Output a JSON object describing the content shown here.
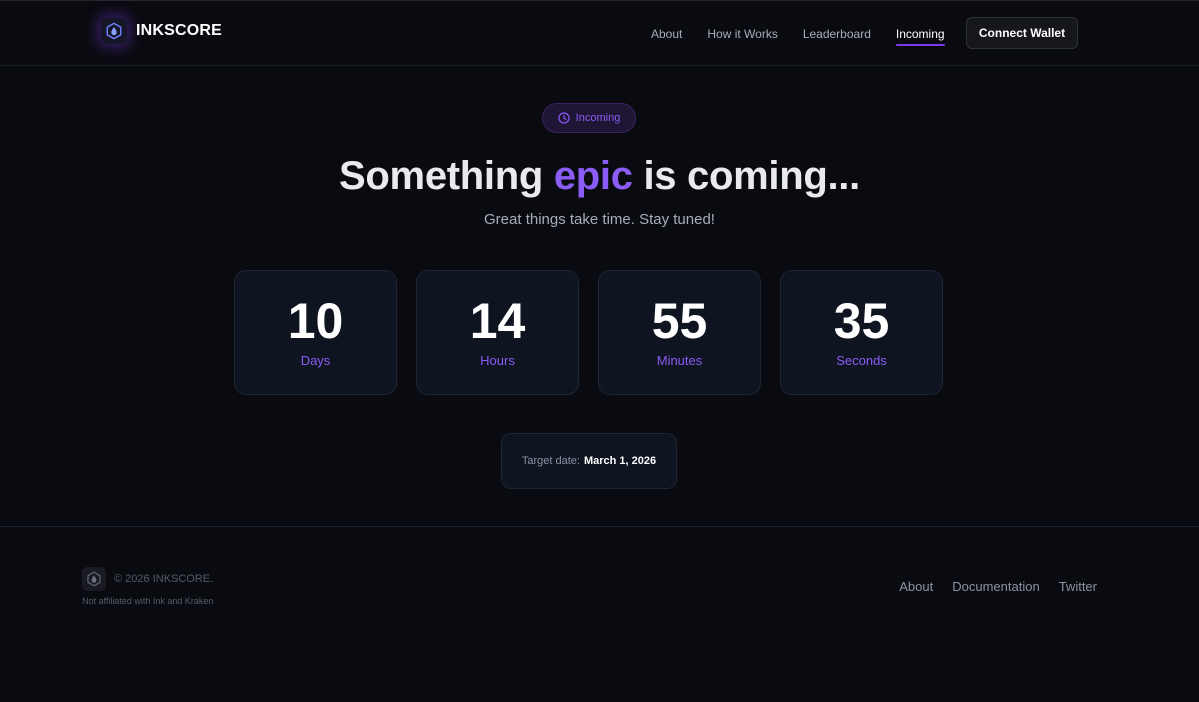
{
  "brand": {
    "name": "INKSCORE",
    "logo_icon": "ink-drop-hexagon-icon"
  },
  "nav": {
    "items": [
      {
        "label": "About",
        "active": false
      },
      {
        "label": "How it Works",
        "active": false
      },
      {
        "label": "Leaderboard",
        "active": false
      },
      {
        "label": "Incoming",
        "active": true
      }
    ],
    "connect_label": "Connect Wallet"
  },
  "hero": {
    "badge": {
      "label": "Incoming",
      "icon": "clock-icon"
    },
    "headline_start": "Something ",
    "headline_accent": "epic",
    "headline_end": " is coming...",
    "subtitle": "Great things take time. Stay tuned!"
  },
  "countdown": [
    {
      "value": "10",
      "label": "Days"
    },
    {
      "value": "14",
      "label": "Hours"
    },
    {
      "value": "55",
      "label": "Minutes"
    },
    {
      "value": "35",
      "label": "Seconds"
    }
  ],
  "target": {
    "label": "Target date:",
    "date": "March 1, 2026"
  },
  "footer": {
    "copyright": "© 2026 INKSCORE.",
    "disclaimer": "Not affiliated with Ink and Kraken",
    "links": [
      "About",
      "Documentation",
      "Twitter"
    ]
  },
  "colors": {
    "background": "#0a0b10",
    "accent": "#8b5cf6",
    "card": "#0e1420"
  }
}
